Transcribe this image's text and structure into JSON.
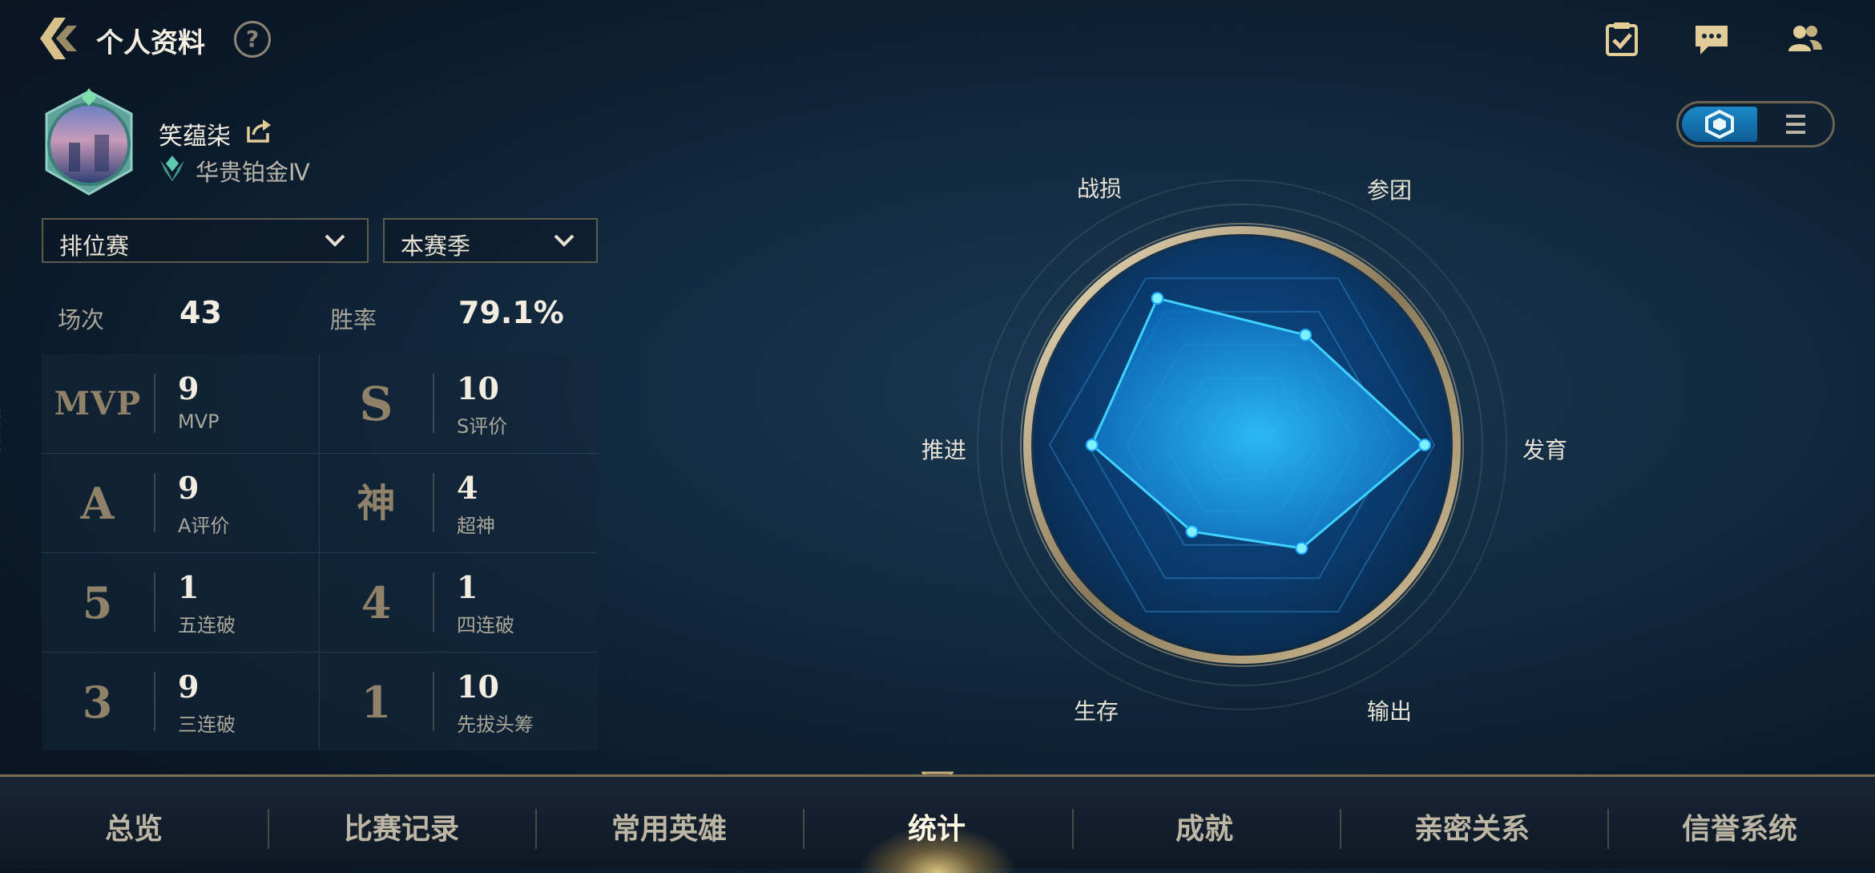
{
  "header": {
    "title": "个人资料",
    "help_label": "?",
    "icons": [
      "task-icon",
      "chat-icon",
      "friends-icon"
    ]
  },
  "profile": {
    "nickname": "笑蕴柒",
    "rank": "华贵铂金Ⅳ"
  },
  "filters": {
    "mode": "排位赛",
    "season": "本赛季"
  },
  "summary": {
    "games_label": "场次",
    "games_value": "43",
    "winrate_label": "胜率",
    "winrate_value": "79.1%"
  },
  "stats": [
    {
      "emblem": "MVP",
      "value": "9",
      "label": "MVP"
    },
    {
      "emblem": "S",
      "value": "10",
      "label": "S评价"
    },
    {
      "emblem": "A",
      "value": "9",
      "label": "A评价"
    },
    {
      "emblem": "神",
      "value": "4",
      "label": "超神"
    },
    {
      "emblem": "5",
      "value": "1",
      "label": "五连破"
    },
    {
      "emblem": "4",
      "value": "1",
      "label": "四连破"
    },
    {
      "emblem": "3",
      "value": "9",
      "label": "三连破"
    },
    {
      "emblem": "1",
      "value": "10",
      "label": "先拔头筹"
    }
  ],
  "side_id": "423448",
  "radar": {
    "axes": [
      "参团",
      "发育",
      "输出",
      "生存",
      "推进",
      "战损"
    ],
    "values": [
      0.66,
      0.95,
      0.62,
      0.52,
      0.78,
      0.88
    ]
  },
  "nav": {
    "items": [
      "总览",
      "比赛记录",
      "常用英雄",
      "统计",
      "成就",
      "亲密关系",
      "信誉系统"
    ],
    "active": "统计"
  },
  "colors": {
    "accent": "#1aa7ff",
    "gold": "#8f8268",
    "background": "#0f2235"
  }
}
